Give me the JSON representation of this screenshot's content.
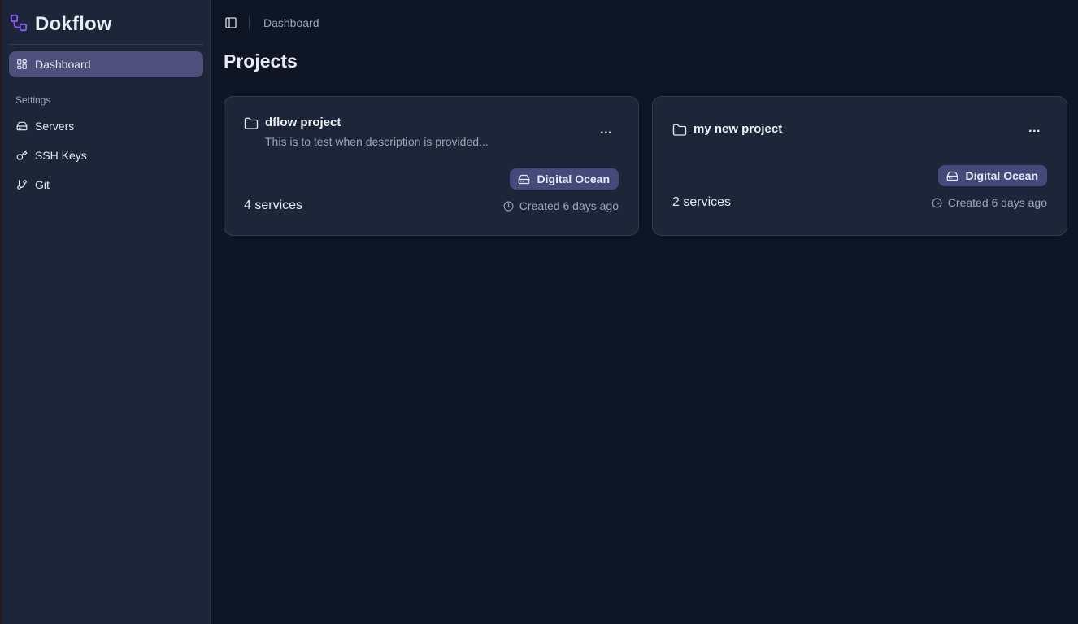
{
  "app": {
    "name": "Dokflow"
  },
  "sidebar": {
    "items": [
      {
        "label": "Dashboard",
        "icon": "layout-dashboard-icon",
        "active": true
      }
    ],
    "section_label": "Settings",
    "settings_items": [
      {
        "label": "Servers",
        "icon": "hard-drive-icon"
      },
      {
        "label": "SSH Keys",
        "icon": "key-icon"
      },
      {
        "label": "Git",
        "icon": "git-branch-icon"
      }
    ]
  },
  "header": {
    "breadcrumb": "Dashboard"
  },
  "main": {
    "title": "Projects",
    "projects": [
      {
        "name": "dflow project",
        "description": "This is to test when description is provided...",
        "provider": "Digital Ocean",
        "services": "4 services",
        "created": "Created 6 days ago"
      },
      {
        "name": "my new project",
        "description": "",
        "provider": "Digital Ocean",
        "services": "2 services",
        "created": "Created 6 days ago"
      }
    ],
    "more_label": "..."
  },
  "colors": {
    "background": "#0e1626",
    "sidebar": "#1d2638",
    "active_nav": "#4f4f7c",
    "badge": "#454a7a",
    "brand_accent": "#8b5cf6"
  }
}
